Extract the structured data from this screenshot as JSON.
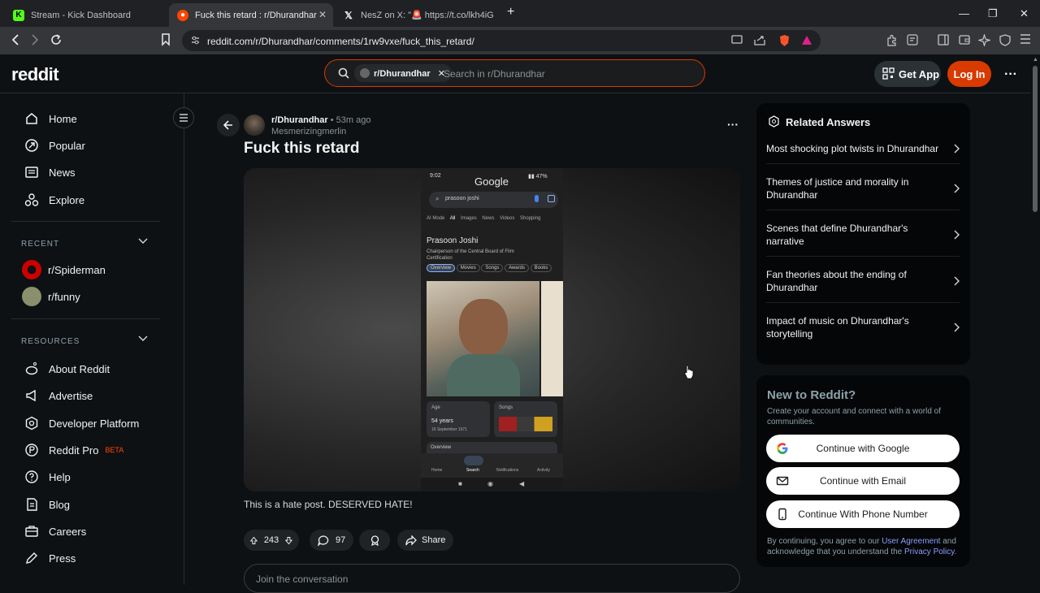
{
  "browser": {
    "tabs": [
      {
        "title": "Stream - Kick Dashboard",
        "icon": "kick-icon"
      },
      {
        "title": "Fuck this retard : r/Dhurandhar",
        "icon": "reddit-icon"
      },
      {
        "title": "NesZ on X: \"🚨 https://t.co/lkh4iG",
        "icon": "x-icon"
      }
    ],
    "url": "reddit.com/r/Dhurandhar/comments/1rw9vxe/fuck_this_retard/"
  },
  "header": {
    "logo": "reddit",
    "search_chip": "r/Dhurandhar",
    "search_placeholder": "Search in r/Dhurandhar",
    "get_app": "Get App",
    "login": "Log In"
  },
  "sidebar": {
    "nav": [
      "Home",
      "Popular",
      "News",
      "Explore"
    ],
    "recent_header": "RECENT",
    "recent": [
      "r/Spiderman",
      "r/funny"
    ],
    "resources_header": "RESOURCES",
    "resources": [
      "About Reddit",
      "Advertise",
      "Developer Platform",
      "Reddit Pro",
      "Help",
      "Blog",
      "Careers",
      "Press"
    ],
    "beta": "BETA"
  },
  "post": {
    "subreddit": "r/Dhurandhar",
    "time": "• 53m ago",
    "author": "Mesmerizingmerlin",
    "title": "Fuck this retard",
    "body": "This is a hate post. DESERVED HATE!",
    "votes": "243",
    "comments": "97",
    "share": "Share",
    "join": "Join the conversation"
  },
  "screenshot": {
    "time": "9:02",
    "brand": "Google",
    "query": "prasoon joshi",
    "tabs": [
      "AI Mode",
      "All",
      "Images",
      "News",
      "Videos",
      "Shopping"
    ],
    "name": "Prasoon Joshi",
    "desc": "Chairperson of the Central Board of Film Certification",
    "chips": [
      "Overview",
      "Movies",
      "Songs",
      "Awards",
      "Books"
    ],
    "age_label": "Age",
    "age_value": "54 years",
    "age_date": "16 September 1971",
    "songs_label": "Songs",
    "overview_label": "Overview",
    "bottom": [
      "Home",
      "Search",
      "Notifications",
      "Activity"
    ]
  },
  "related": {
    "title": "Related Answers",
    "items": [
      "Most shocking plot twists in Dhurandhar",
      "Themes of justice and morality in Dhurandhar",
      "Scenes that define Dhurandhar's narrative",
      "Fan theories about the ending of Dhurandhar",
      "Impact of music on Dhurandhar's storytelling"
    ]
  },
  "signup": {
    "title": "New to Reddit?",
    "desc": "Create your account and connect with a world of communities.",
    "google": "Continue with Google",
    "email": "Continue with Email",
    "phone": "Continue With Phone Number",
    "legal_a": "By continuing, you agree to our ",
    "user_agreement": "User Agreement",
    "legal_b": " and acknowledge that you understand the ",
    "privacy": "Privacy Policy",
    "legal_c": "."
  },
  "colors": {
    "accent": "#d93a00",
    "link": "#8d9cff"
  }
}
